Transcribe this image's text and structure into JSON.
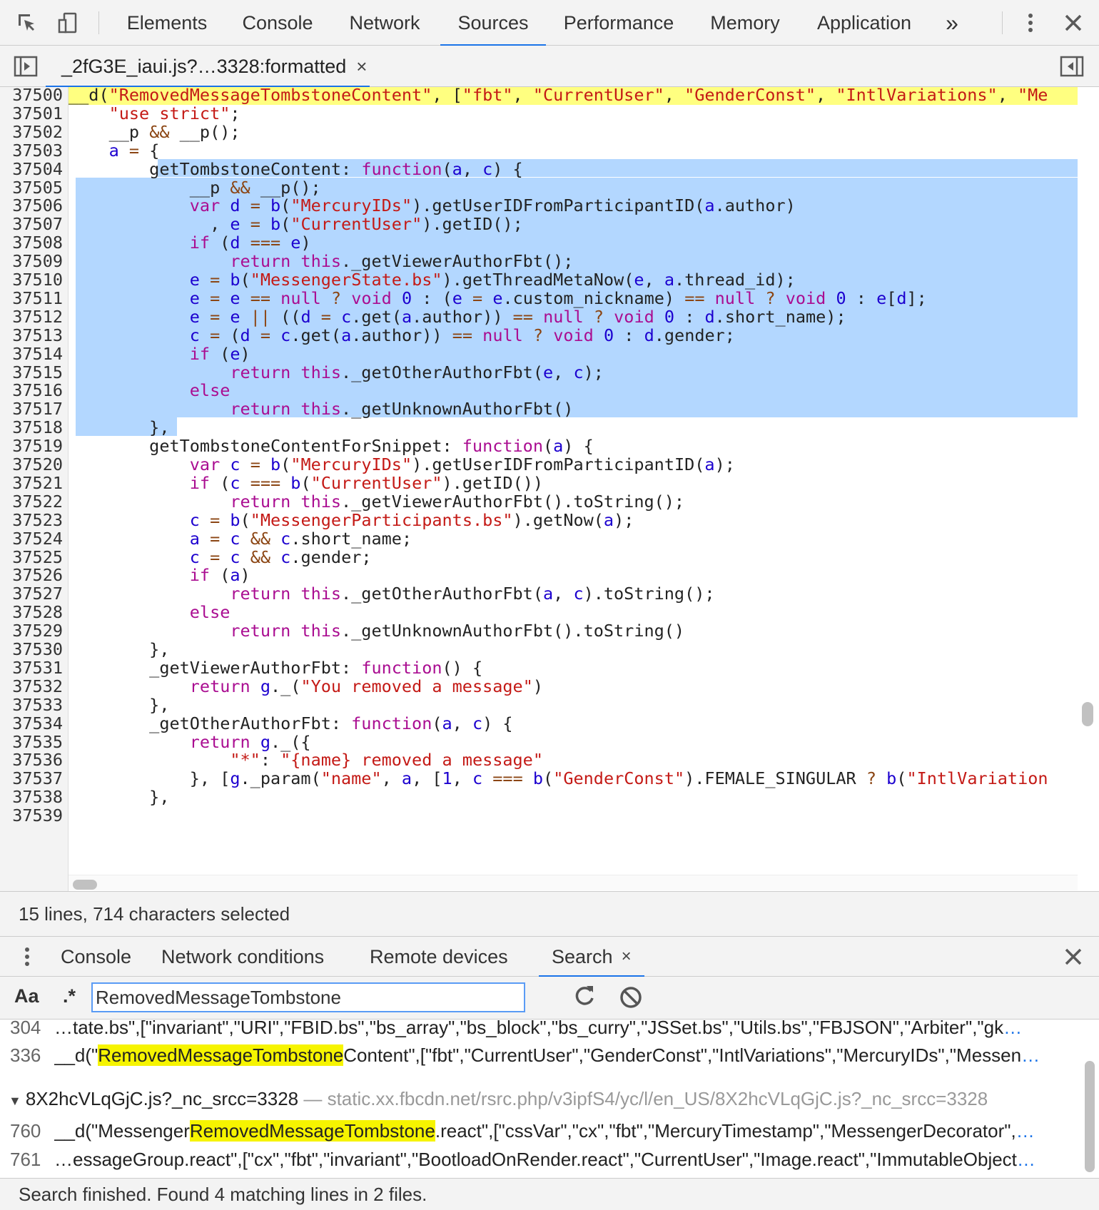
{
  "toolbar": {
    "tabs": [
      "Elements",
      "Console",
      "Network",
      "Sources",
      "Performance",
      "Memory",
      "Application"
    ],
    "active_tab": "Sources",
    "more_label": "»"
  },
  "file_tab": {
    "name": "_2fG3E_iaui.js?…3328:formatted",
    "close": "×"
  },
  "editor": {
    "lines": [
      {
        "n": "37500",
        "html": "__d(<s>\"RemovedMessageTombstoneContent\"</s>, [<s>\"fbt\"</s>, <s>\"CurrentUser\"</s>, <s>\"GenderConst\"</s>, <s>\"IntlVariations\"</s>, <s>\"Me</s>"
      },
      {
        "n": "37501",
        "html": "    <s>\"use strict\"</s>;"
      },
      {
        "n": "37502",
        "html": "    __p <o>&&</o> __p();"
      },
      {
        "n": "37503",
        "html": "    <v>a</v> <o>=</o> {"
      },
      {
        "n": "37504",
        "html": "        getTombstoneContent: <k>function</k>(<v>a</v>, <v>c</v>) {"
      },
      {
        "n": "37505",
        "html": "            __p <o>&&</o> __p();"
      },
      {
        "n": "37506",
        "html": "            <k>var</k> <v>d</v> <o>=</o> <v>b</v>(<s>\"MercuryIDs\"</s>).getUserIDFromParticipantID(<v>a</v>.author)"
      },
      {
        "n": "37507",
        "html": "              , <v>e</v> <o>=</o> <v>b</v>(<s>\"CurrentUser\"</s>).getID();"
      },
      {
        "n": "37508",
        "html": "            <k>if</k> (<v>d</v> <o>===</o> <v>e</v>)"
      },
      {
        "n": "37509",
        "html": "                <k>return</k> <k>this</k>._getViewerAuthorFbt();"
      },
      {
        "n": "37510",
        "html": "            <v>e</v> <o>=</o> <v>b</v>(<s>\"MessengerState.bs\"</s>).getThreadMetaNow(<v>e</v>, <v>a</v>.thread_id);"
      },
      {
        "n": "37511",
        "html": "            <v>e</v> <o>=</o> <v>e</v> <o>==</o> <k>null</k> <o>?</o> <k>void</k> <v>0</v> : (<v>e</v> <o>=</o> <v>e</v>.custom_nickname) <o>==</o> <k>null</k> <o>?</o> <k>void</k> <v>0</v> : <v>e</v>[<v>d</v>];"
      },
      {
        "n": "37512",
        "html": "            <v>e</v> <o>=</o> <v>e</v> <o>||</o> ((<v>d</v> <o>=</o> <v>c</v>.get(<v>a</v>.author)) <o>==</o> <k>null</k> <o>?</o> <k>void</k> <v>0</v> : <v>d</v>.short_name);"
      },
      {
        "n": "37513",
        "html": "            <v>c</v> <o>=</o> (<v>d</v> <o>=</o> <v>c</v>.get(<v>a</v>.author)) <o>==</o> <k>null</k> <o>?</o> <k>void</k> <v>0</v> : <v>d</v>.gender;"
      },
      {
        "n": "37514",
        "html": "            <k>if</k> (<v>e</v>)"
      },
      {
        "n": "37515",
        "html": "                <k>return</k> <k>this</k>._getOtherAuthorFbt(<v>e</v>, <v>c</v>);"
      },
      {
        "n": "37516",
        "html": "            <k>else</k>"
      },
      {
        "n": "37517",
        "html": "                <k>return</k> <k>this</k>._getUnknownAuthorFbt()"
      },
      {
        "n": "37518",
        "html": "        },"
      },
      {
        "n": "37519",
        "html": "        getTombstoneContentForSnippet: <k>function</k>(<v>a</v>) {"
      },
      {
        "n": "37520",
        "html": "            <k>var</k> <v>c</v> <o>=</o> <v>b</v>(<s>\"MercuryIDs\"</s>).getUserIDFromParticipantID(<v>a</v>);"
      },
      {
        "n": "37521",
        "html": "            <k>if</k> (<v>c</v> <o>===</o> <v>b</v>(<s>\"CurrentUser\"</s>).getID())"
      },
      {
        "n": "37522",
        "html": "                <k>return</k> <k>this</k>._getViewerAuthorFbt().toString();"
      },
      {
        "n": "37523",
        "html": "            <v>c</v> <o>=</o> <v>b</v>(<s>\"MessengerParticipants.bs\"</s>).getNow(<v>a</v>);"
      },
      {
        "n": "37524",
        "html": "            <v>a</v> <o>=</o> <v>c</v> <o>&&</o> <v>c</v>.short_name;"
      },
      {
        "n": "37525",
        "html": "            <v>c</v> <o>=</o> <v>c</v> <o>&&</o> <v>c</v>.gender;"
      },
      {
        "n": "37526",
        "html": "            <k>if</k> (<v>a</v>)"
      },
      {
        "n": "37527",
        "html": "                <k>return</k> <k>this</k>._getOtherAuthorFbt(<v>a</v>, <v>c</v>).toString();"
      },
      {
        "n": "37528",
        "html": "            <k>else</k>"
      },
      {
        "n": "37529",
        "html": "                <k>return</k> <k>this</k>._getUnknownAuthorFbt().toString()"
      },
      {
        "n": "37530",
        "html": "        },"
      },
      {
        "n": "37531",
        "html": "        _getViewerAuthorFbt: <k>function</k>() {"
      },
      {
        "n": "37532",
        "html": "            <k>return</k> <v>g</v>._(<s>\"You removed a message\"</s>)"
      },
      {
        "n": "37533",
        "html": "        },"
      },
      {
        "n": "37534",
        "html": "        _getOtherAuthorFbt: <k>function</k>(<v>a</v>, <v>c</v>) {"
      },
      {
        "n": "37535",
        "html": "            <k>return</k> <v>g</v>._({"
      },
      {
        "n": "37536",
        "html": "                <s>\"*\"</s>: <s>\"{name} removed a message\"</s>"
      },
      {
        "n": "37537",
        "html": "            }, [<v>g</v>._param(<s>\"name\"</s>, <v>a</v>, [<v>1</v>, <v>c</v> <o>===</o> <v>b</v>(<s>\"GenderConst\"</s>).FEMALE_SINGULAR <o>?</o> <v>b</v>(<s>\"IntlVariation</s>"
      },
      {
        "n": "37538",
        "html": "        },"
      },
      {
        "n": "37539",
        "html": ""
      }
    ]
  },
  "status": {
    "text": "15 lines, 714 characters selected"
  },
  "drawer": {
    "tabs": [
      "Console",
      "Network conditions",
      "Remote devices",
      "Search"
    ],
    "active_tab": "Search",
    "tab_close": "×"
  },
  "search": {
    "case_label": "Aa",
    "regex_label": ".*",
    "query": "RemovedMessageTombstone"
  },
  "results": {
    "rows": [
      {
        "num": "304",
        "pre": "…tate.bs\",[\"invariant\",\"URI\",\"FBID.bs\",\"bs_array\",\"bs_block\",\"bs_curry\",\"JSSet.bs\",\"Utils.bs\",\"FBJSON\",\"Arbiter\",\"gk",
        "match": "",
        "post": ""
      },
      {
        "num": "336",
        "pre": "__d(\"",
        "match": "RemovedMessageTombstone",
        "post": "Content\",[\"fbt\",\"CurrentUser\",\"GenderConst\",\"IntlVariations\",\"MercuryIDs\",\"Messen"
      },
      {
        "num": "760",
        "pre": "__d(\"Messenger",
        "match": "RemovedMessageTombstone",
        "post": ".react\",[\"cssVar\",\"cx\",\"fbt\",\"MercuryTimestamp\",\"MessengerDecorator\","
      },
      {
        "num": "761",
        "pre": "…essageGroup.react\",[\"cx\",\"fbt\",\"invariant\",\"BootloadOnRender.react\",\"CurrentUser\",\"Image.react\",\"ImmutableObject",
        "match": "",
        "post": ""
      }
    ],
    "file_group": {
      "name": "8X2hcVLqGjC.js?_nc_srcc=3328",
      "dash": "—",
      "path": "static.xx.fbcdn.net/rsrc.php/v3ipfS4/yc/l/en_US/8X2hcVLqGjC.js?_nc_srcc=3328"
    },
    "ellipsis": "…"
  },
  "footer": {
    "text": "Search finished.  Found 4 matching lines in 2 files."
  },
  "colors": {
    "accent": "#1a73e8",
    "selection": "#b3d7ff",
    "line_highlight": "#ffff80",
    "match_highlight": "#f6f400",
    "string": "#c41a16",
    "keyword": "#aa0d91",
    "variable": "#1c00cf",
    "operator": "#8b4513"
  }
}
